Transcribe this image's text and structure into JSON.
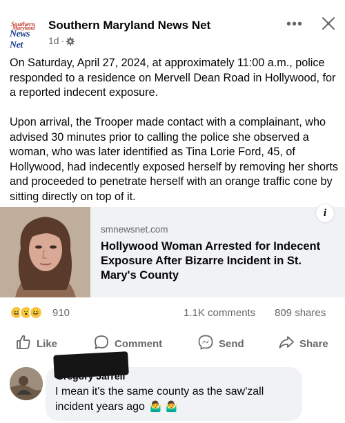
{
  "header": {
    "logo_lines": [
      "Southern",
      "Maryland",
      "News Net"
    ],
    "page_name": "Southern Maryland News Net",
    "time": "1d",
    "separator": "·",
    "more_icon": "more-dots-icon",
    "close_icon": "close-icon"
  },
  "post": {
    "paragraphs": [
      "On Saturday, April 27, 2024, at approximately 11:00 a.m., police responded to a residence on Mervell Dean Road in Hollywood, for a reported indecent exposure.",
      "Upon arrival, the Trooper made contact with a complainant, who advised 30 minutes prior to calling the police she observed a woman, who was later identified as Tina Lorie Ford, 45, of Hollywood, had indecently exposed herself by removing her shorts and proceeded to penetrate herself with an orange traffic cone by sitting directly on top of it."
    ]
  },
  "link_card": {
    "domain": "smnewsnet.com",
    "title": "Hollywood Woman Arrested for Indecent Exposure After Bizarre Incident in St. Mary's County",
    "info_label": "i"
  },
  "stats": {
    "reaction_icons": [
      "haha-reaction-icon",
      "wow-reaction-icon",
      "haha-reaction-icon"
    ],
    "reaction_count": "910",
    "comments": "1.1K comments",
    "shares": "809 shares"
  },
  "actions": {
    "like": "Like",
    "comment": "Comment",
    "send": "Send",
    "share": "Share"
  },
  "comment": {
    "name": "Gregory Jarrell",
    "text": "I mean it's the same county as the saw'zall incident years ago",
    "emoji": "🤷‍♂️ 🤷‍♂️"
  },
  "colors": {
    "text": "#050505",
    "secondary": "#65676b",
    "card_bg": "#f0f2f5"
  }
}
